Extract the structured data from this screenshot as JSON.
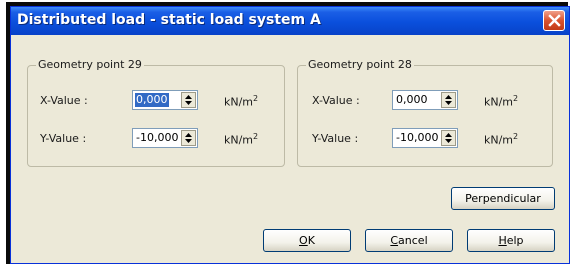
{
  "dialog": {
    "title": "Distributed load - static load system A",
    "close_icon": "close-icon"
  },
  "point_a": {
    "legend": "Geometry point 29",
    "x_label": "X-Value :",
    "x_value": "0,000",
    "y_label": "Y-Value :",
    "y_value": "-10,000",
    "unit": "kN/m",
    "unit_exp": "2"
  },
  "point_b": {
    "legend": "Geometry point 28",
    "x_label": "X-Value :",
    "x_value": "0,000",
    "y_label": "Y-Value :",
    "y_value": "-10,000",
    "unit": "kN/m",
    "unit_exp": "2"
  },
  "buttons": {
    "perpendicular": "Perpendicular",
    "ok_mnemonic": "O",
    "ok_rest": "K",
    "cancel_mnemonic": "C",
    "cancel_rest": "ancel",
    "help_mnemonic": "H",
    "help_rest": "elp"
  },
  "colors": {
    "title_bar": "#0a4fdc",
    "dialog_bg": "#ece9d8",
    "selection": "#316ac5",
    "close_button": "#d9532f"
  }
}
